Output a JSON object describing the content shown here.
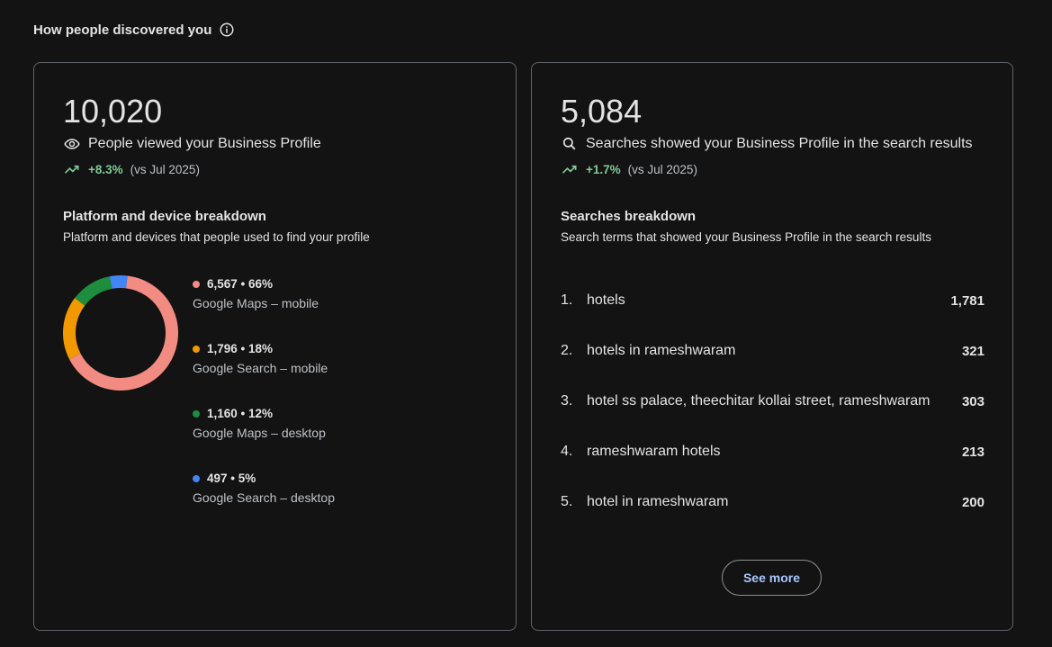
{
  "header": {
    "title": "How people discovered you",
    "info_icon": "info-icon"
  },
  "views_card": {
    "total": "10,020",
    "metric_icon": "eye-icon",
    "metric_label": "People viewed your Business Profile",
    "trend_icon": "trending-up-icon",
    "trend_value": "+8.3%",
    "trend_compare": "(vs Jul 2025)",
    "breakdown_title": "Platform and device breakdown",
    "breakdown_desc": "Platform and devices that people used to find your profile",
    "legend": [
      {
        "value_text": "6,567 • 66%",
        "label": "Google Maps – mobile",
        "color": "#f28b82"
      },
      {
        "value_text": "1,796 • 18%",
        "label": "Google Search – mobile",
        "color": "#f29900"
      },
      {
        "value_text": "1,160 • 12%",
        "label": "Google Maps – desktop",
        "color": "#1e8e3e"
      },
      {
        "value_text": "497 • 5%",
        "label": "Google Search – desktop",
        "color": "#4285f4"
      }
    ]
  },
  "chart_data": {
    "type": "pie",
    "categories": [
      "Google Maps – mobile",
      "Google Search – mobile",
      "Google Maps – desktop",
      "Google Search – desktop"
    ],
    "values": [
      6567,
      1796,
      1160,
      497
    ],
    "colors": [
      "#f28b82",
      "#f29900",
      "#1e8e3e",
      "#4285f4"
    ],
    "title": "",
    "donut": true
  },
  "searches_card": {
    "total": "5,084",
    "metric_icon": "search-icon",
    "metric_label": "Searches showed your Business Profile in the search results",
    "trend_icon": "trending-up-icon",
    "trend_value": "+1.7%",
    "trend_compare": "(vs Jul 2025)",
    "breakdown_title": "Searches breakdown",
    "breakdown_desc": "Search terms that showed your Business Profile in the search results",
    "terms": [
      {
        "rank": "1.",
        "term": "hotels",
        "count": "1,781"
      },
      {
        "rank": "2.",
        "term": "hotels in rameshwaram",
        "count": "321"
      },
      {
        "rank": "3.",
        "term": "hotel ss palace, theechitar kollai street, rameshwaram",
        "count": "303"
      },
      {
        "rank": "4.",
        "term": "rameshwaram hotels",
        "count": "213"
      },
      {
        "rank": "5.",
        "term": "hotel in rameshwaram",
        "count": "200"
      }
    ],
    "see_more_label": "See more"
  }
}
